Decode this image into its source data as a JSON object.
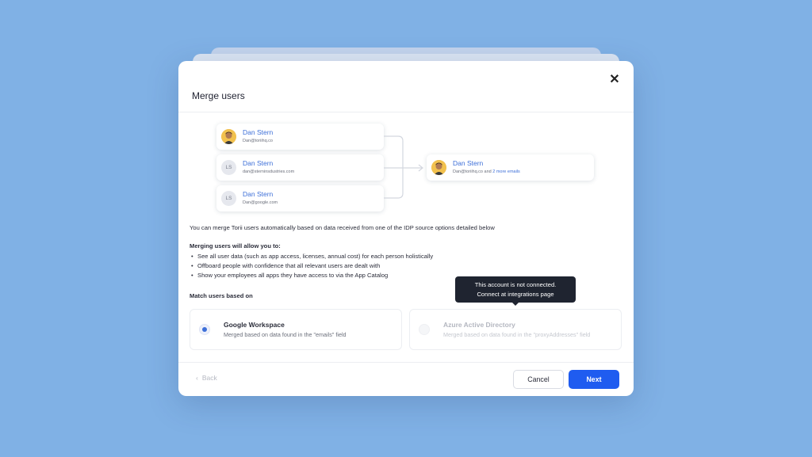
{
  "modal": {
    "title": "Merge users",
    "close_icon": "close-icon"
  },
  "diagram": {
    "source_users": [
      {
        "name": "Dan Stern",
        "email": "Dan@toriihq.co",
        "avatar": "photo"
      },
      {
        "name": "Dan Stern",
        "email": "dan@sterninsdustries.com",
        "avatar": "initials",
        "initials": "LS"
      },
      {
        "name": "Dan Stern",
        "email": "Dan@google.com",
        "avatar": "initials",
        "initials": "LS"
      }
    ],
    "merged_user": {
      "name": "Dan Stern",
      "email": "Dan@toriihq.co",
      "email_suffix": " and ",
      "more_link": "2 more emails"
    }
  },
  "info_text": "You can merge Torii users automatically based on data received from one of the IDP source options detailed below",
  "benefits": {
    "title": "Merging users will allow you to:",
    "items": [
      "See all user data (such as app access, licenses, annual cost) for each person holistically",
      "Offboard people with confidence that all relevant users are dealt with",
      "Show your employees all apps they have access to via the App Catalog"
    ]
  },
  "match": {
    "title": "Match users based on",
    "options": [
      {
        "title": "Google Workspace",
        "description": "Merged based on data found in the \"emails\" field",
        "selected": true,
        "disabled": false
      },
      {
        "title": "Azure Active Directory",
        "description": "Merged based on data found in the \"proxyAddresses\" field",
        "selected": false,
        "disabled": true
      }
    ]
  },
  "tooltip": {
    "line1": "This account is not connected.",
    "line2": "Connect at integrations page"
  },
  "footer": {
    "back_label": "Back",
    "cancel_label": "Cancel",
    "next_label": "Next"
  },
  "colors": {
    "background": "#80b1e5",
    "primary": "#1f5cf0",
    "link": "#3d6fd8",
    "tooltip_bg": "#1f2430"
  }
}
